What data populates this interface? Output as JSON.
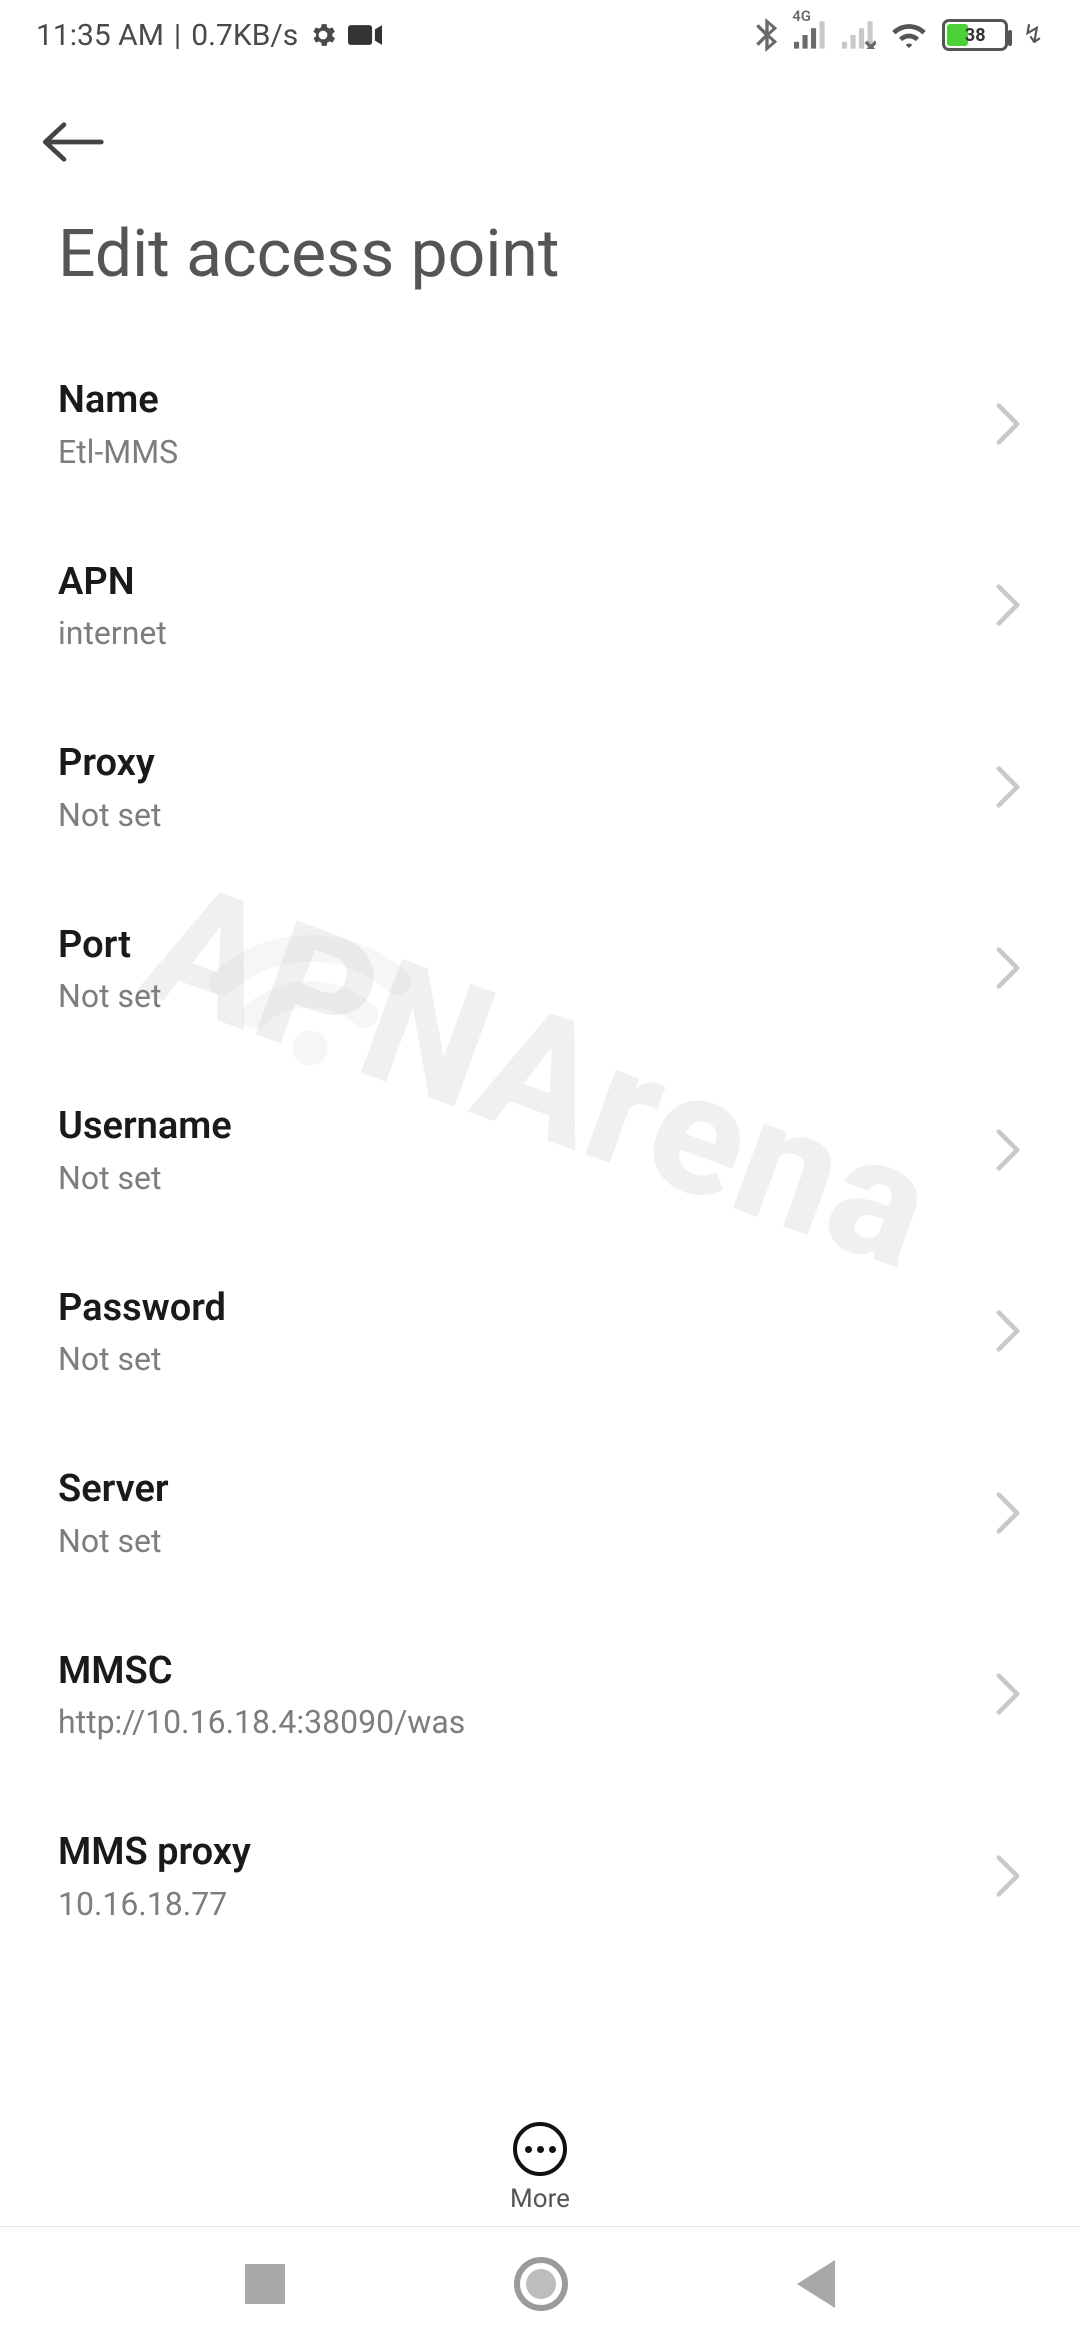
{
  "status": {
    "time": "11:35 AM",
    "rate": "0.7KB/s",
    "battery_percent": "38",
    "sim1_label": "4G"
  },
  "header": {
    "title": "Edit access point"
  },
  "rows": [
    {
      "title": "Name",
      "value": "Etl-MMS"
    },
    {
      "title": "APN",
      "value": "internet"
    },
    {
      "title": "Proxy",
      "value": "Not set"
    },
    {
      "title": "Port",
      "value": "Not set"
    },
    {
      "title": "Username",
      "value": "Not set"
    },
    {
      "title": "Password",
      "value": "Not set"
    },
    {
      "title": "Server",
      "value": "Not set"
    },
    {
      "title": "MMSC",
      "value": "http://10.16.18.4:38090/was"
    },
    {
      "title": "MMS proxy",
      "value": "10.16.18.77"
    }
  ],
  "bottom": {
    "more": "More"
  },
  "watermark": "APNArena"
}
